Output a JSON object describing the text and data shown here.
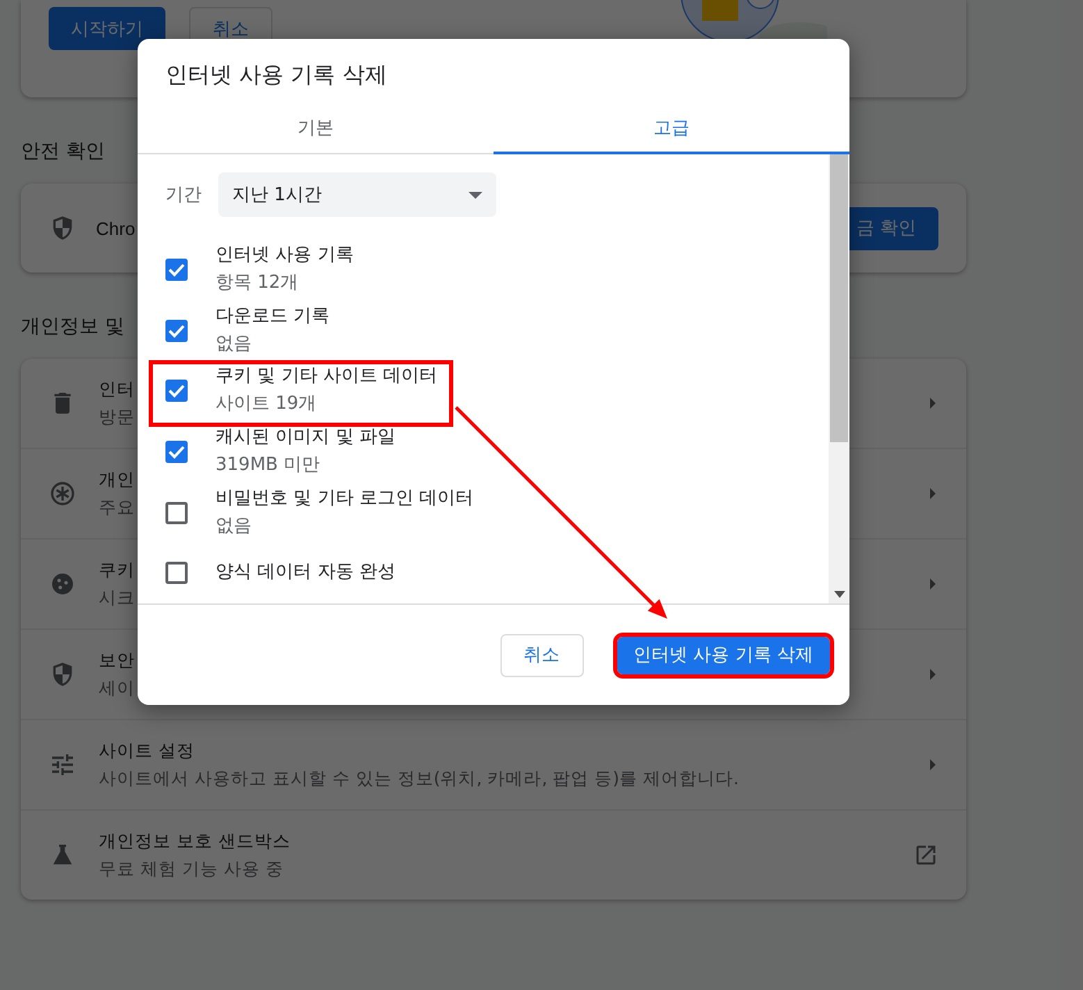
{
  "top_card": {
    "buttons": [
      {
        "label": "시작하기",
        "kind": "primary"
      },
      {
        "label": "취소",
        "kind": "secondary"
      }
    ]
  },
  "safety_check": {
    "heading": "안전 확인",
    "item_text": "Chro",
    "button": "금 확인"
  },
  "privacy_section": {
    "heading": "개인정보 및",
    "rows": [
      {
        "kind": "trash",
        "title": "인터",
        "subtitle": "방문",
        "external": false
      },
      {
        "kind": "asterisk",
        "title": "개인",
        "subtitle": "주요",
        "external": false
      },
      {
        "kind": "cookie",
        "title": "쿠키",
        "subtitle": "시크",
        "external": false
      },
      {
        "kind": "shield",
        "title": "보안",
        "subtitle": "세이",
        "external": false
      },
      {
        "kind": "tune",
        "title": "사이트 설정",
        "subtitle": "사이트에서 사용하고 표시할 수 있는 정보(위치, 카메라, 팝업 등)를 제어합니다.",
        "external": false
      },
      {
        "kind": "flask",
        "title": "개인정보 보호 샌드박스",
        "subtitle": "무료 체험 기능 사용 중",
        "external": true
      }
    ]
  },
  "dialog": {
    "title": "인터넷 사용 기록 삭제",
    "tabs": [
      {
        "label": "기본",
        "selected": false
      },
      {
        "label": "고급",
        "selected": true
      }
    ],
    "period": {
      "label": "기간",
      "value": "지난 1시간"
    },
    "items": [
      {
        "title": "인터넷 사용 기록",
        "subtitle": "항목 12개",
        "checked": true,
        "highlighted": false
      },
      {
        "title": "다운로드 기록",
        "subtitle": "없음",
        "checked": true,
        "highlighted": false
      },
      {
        "title": "쿠키 및 기타 사이트 데이터",
        "subtitle": "사이트 19개",
        "checked": true,
        "highlighted": true
      },
      {
        "title": "캐시된 이미지 및 파일",
        "subtitle": "319MB 미만",
        "checked": true,
        "highlighted": false
      },
      {
        "title": "비밀번호 및 기타 로그인 데이터",
        "subtitle": "없음",
        "checked": false,
        "highlighted": false
      },
      {
        "title": "양식 데이터 자동 완성",
        "checked": false,
        "highlighted": false
      }
    ],
    "buttons": [
      {
        "label": "취소",
        "kind": "secondary",
        "highlighted": false
      },
      {
        "label": "인터넷 사용 기록 삭제",
        "kind": "primary",
        "highlighted": true
      }
    ]
  }
}
